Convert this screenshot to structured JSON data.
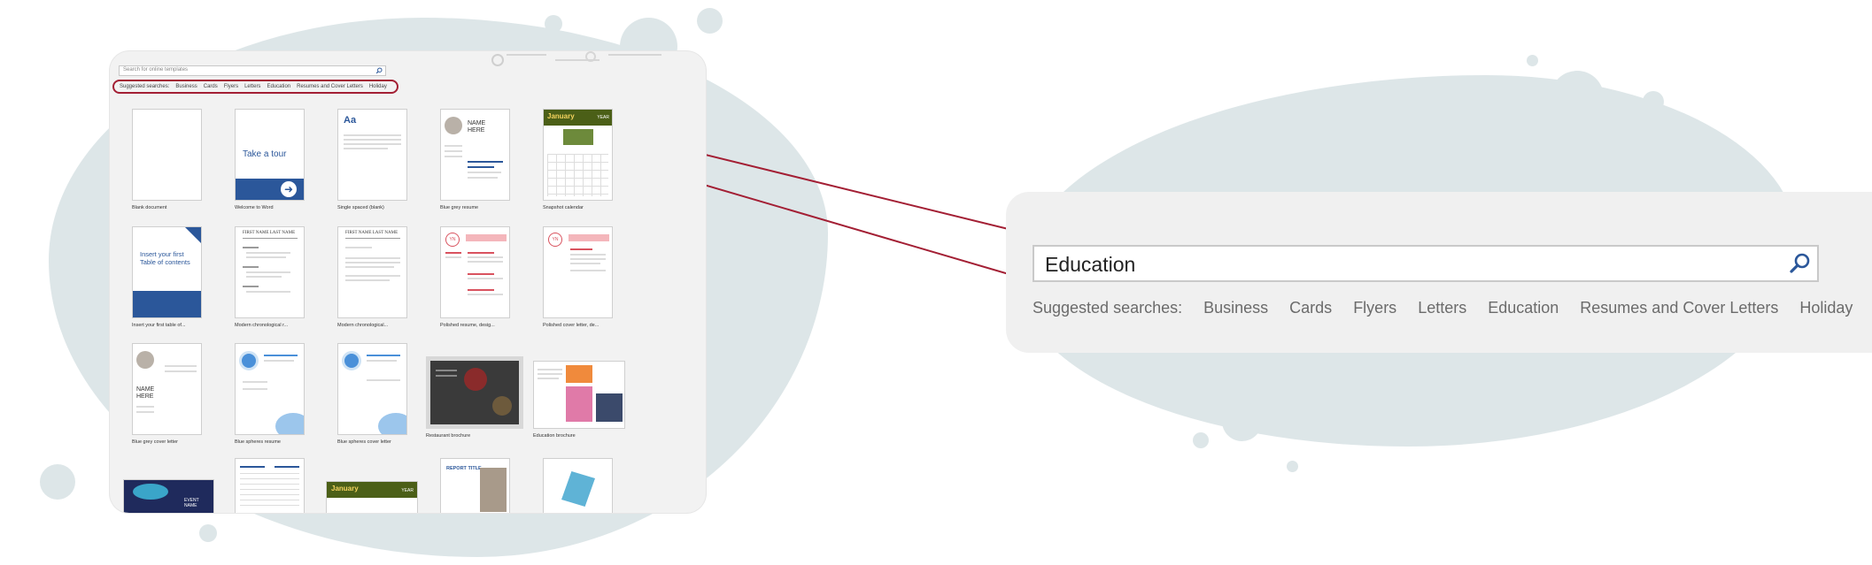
{
  "search": {
    "placeholder": "Search for online templates",
    "value": "Education"
  },
  "suggested": {
    "label": "Suggested searches:",
    "items": [
      "Business",
      "Cards",
      "Flyers",
      "Letters",
      "Education",
      "Resumes and Cover Letters",
      "Holiday"
    ]
  },
  "templates": [
    {
      "caption": "Blank document"
    },
    {
      "caption": "Welcome to Word",
      "text": "Take a tour"
    },
    {
      "caption": "Single spaced (blank)",
      "text": "Aa"
    },
    {
      "caption": "Blue grey resume",
      "text": "NAME HERE"
    },
    {
      "caption": "Snapshot calendar",
      "text": "January",
      "text2": "YEAR"
    },
    {
      "caption": "Insert your first table of...",
      "text": "Insert your first Table of contents"
    },
    {
      "caption": "Modern chronological r...",
      "text": "FIRST NAME LAST NAME"
    },
    {
      "caption": "Modern chronological...",
      "text": "FIRST NAME LAST NAME"
    },
    {
      "caption": "Polished resume, desig...",
      "text": "YN"
    },
    {
      "caption": "Polished cover letter, de...",
      "text": "YN"
    },
    {
      "caption": "Blue grey cover letter",
      "text": "NAME HERE"
    },
    {
      "caption": "Blue spheres resume"
    },
    {
      "caption": "Blue spheres cover letter"
    },
    {
      "caption": "Restaurant brochure"
    },
    {
      "caption": "Education brochure"
    }
  ],
  "partial_row": {
    "event": "EVENT NAME",
    "calendar": "January",
    "calendar_year": "YEAR",
    "report": "REPORT TITLE"
  },
  "colors": {
    "accent": "#a31f34",
    "word_blue": "#2b579a",
    "background_blob": "#dde6e8",
    "calendar_green": "#4b5f17"
  }
}
